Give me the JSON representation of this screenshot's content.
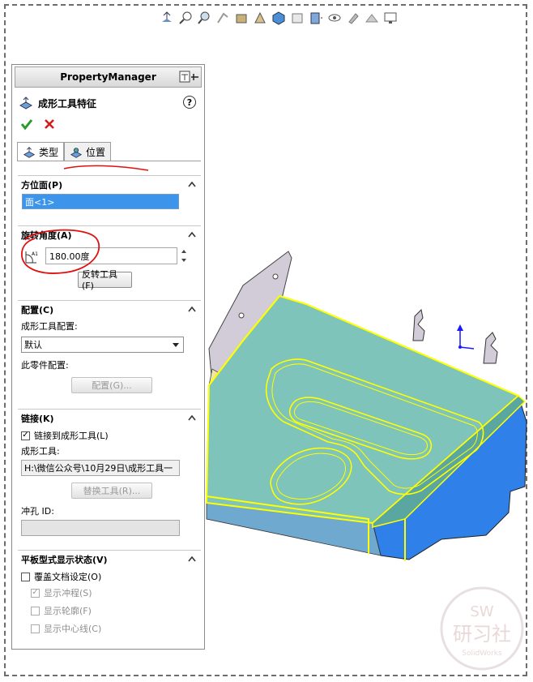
{
  "toolbar": {
    "icons": [
      "view-orient-icon",
      "zoom-fit-icon",
      "zoom-area-icon",
      "previous-view-icon",
      "section-view-icon",
      "dynamic-annotation-icon",
      "view-cube-icon",
      "view-orientation-icon",
      "display-style-icon",
      "hide-show-icon",
      "edit-appearance-icon",
      "apply-scene-icon",
      "view-settings-icon"
    ]
  },
  "pm": {
    "title": "PropertyManager",
    "feature_title": "成形工具特征",
    "help": "?",
    "tabs": [
      {
        "label": "类型"
      },
      {
        "label": "位置"
      }
    ],
    "sections": {
      "orientation": {
        "title": "方位面(P)",
        "value": "面<1>"
      },
      "rotation": {
        "title": "旋转角度(A)",
        "angle": "180.00度",
        "reverse_btn": "反转工具(F)"
      },
      "config": {
        "title": "配置(C)",
        "tool_config_label": "成形工具配置:",
        "tool_config_value": "默认",
        "part_config_label": "此零件配置:",
        "config_btn": "配置(G)..."
      },
      "link": {
        "title": "链接(K)",
        "link_check": "链接到成形工具(L)",
        "tool_label": "成形工具:",
        "tool_path": "H:\\微信公众号\\10月29日\\成形工具一",
        "replace_btn": "替换工具(R)...",
        "punch_label": "冲孔 ID:",
        "punch_value": ""
      },
      "flat": {
        "title": "平板型式显示状态(V)",
        "override": "覆盖文档设定(O)",
        "show_punch": "显示冲程(S)",
        "show_profile": "显示轮廓(F)",
        "show_center": "显示中心线(C)"
      }
    }
  },
  "watermark": {
    "top": "SW",
    "main": "研习社",
    "sub": "SolidWorks"
  },
  "colors": {
    "accent_blue": "#3c95ea",
    "model_teal": "#7ec4bb",
    "model_blue": "#2f80e8",
    "highlight": "#ffff00",
    "annotation_red": "#e01010"
  }
}
